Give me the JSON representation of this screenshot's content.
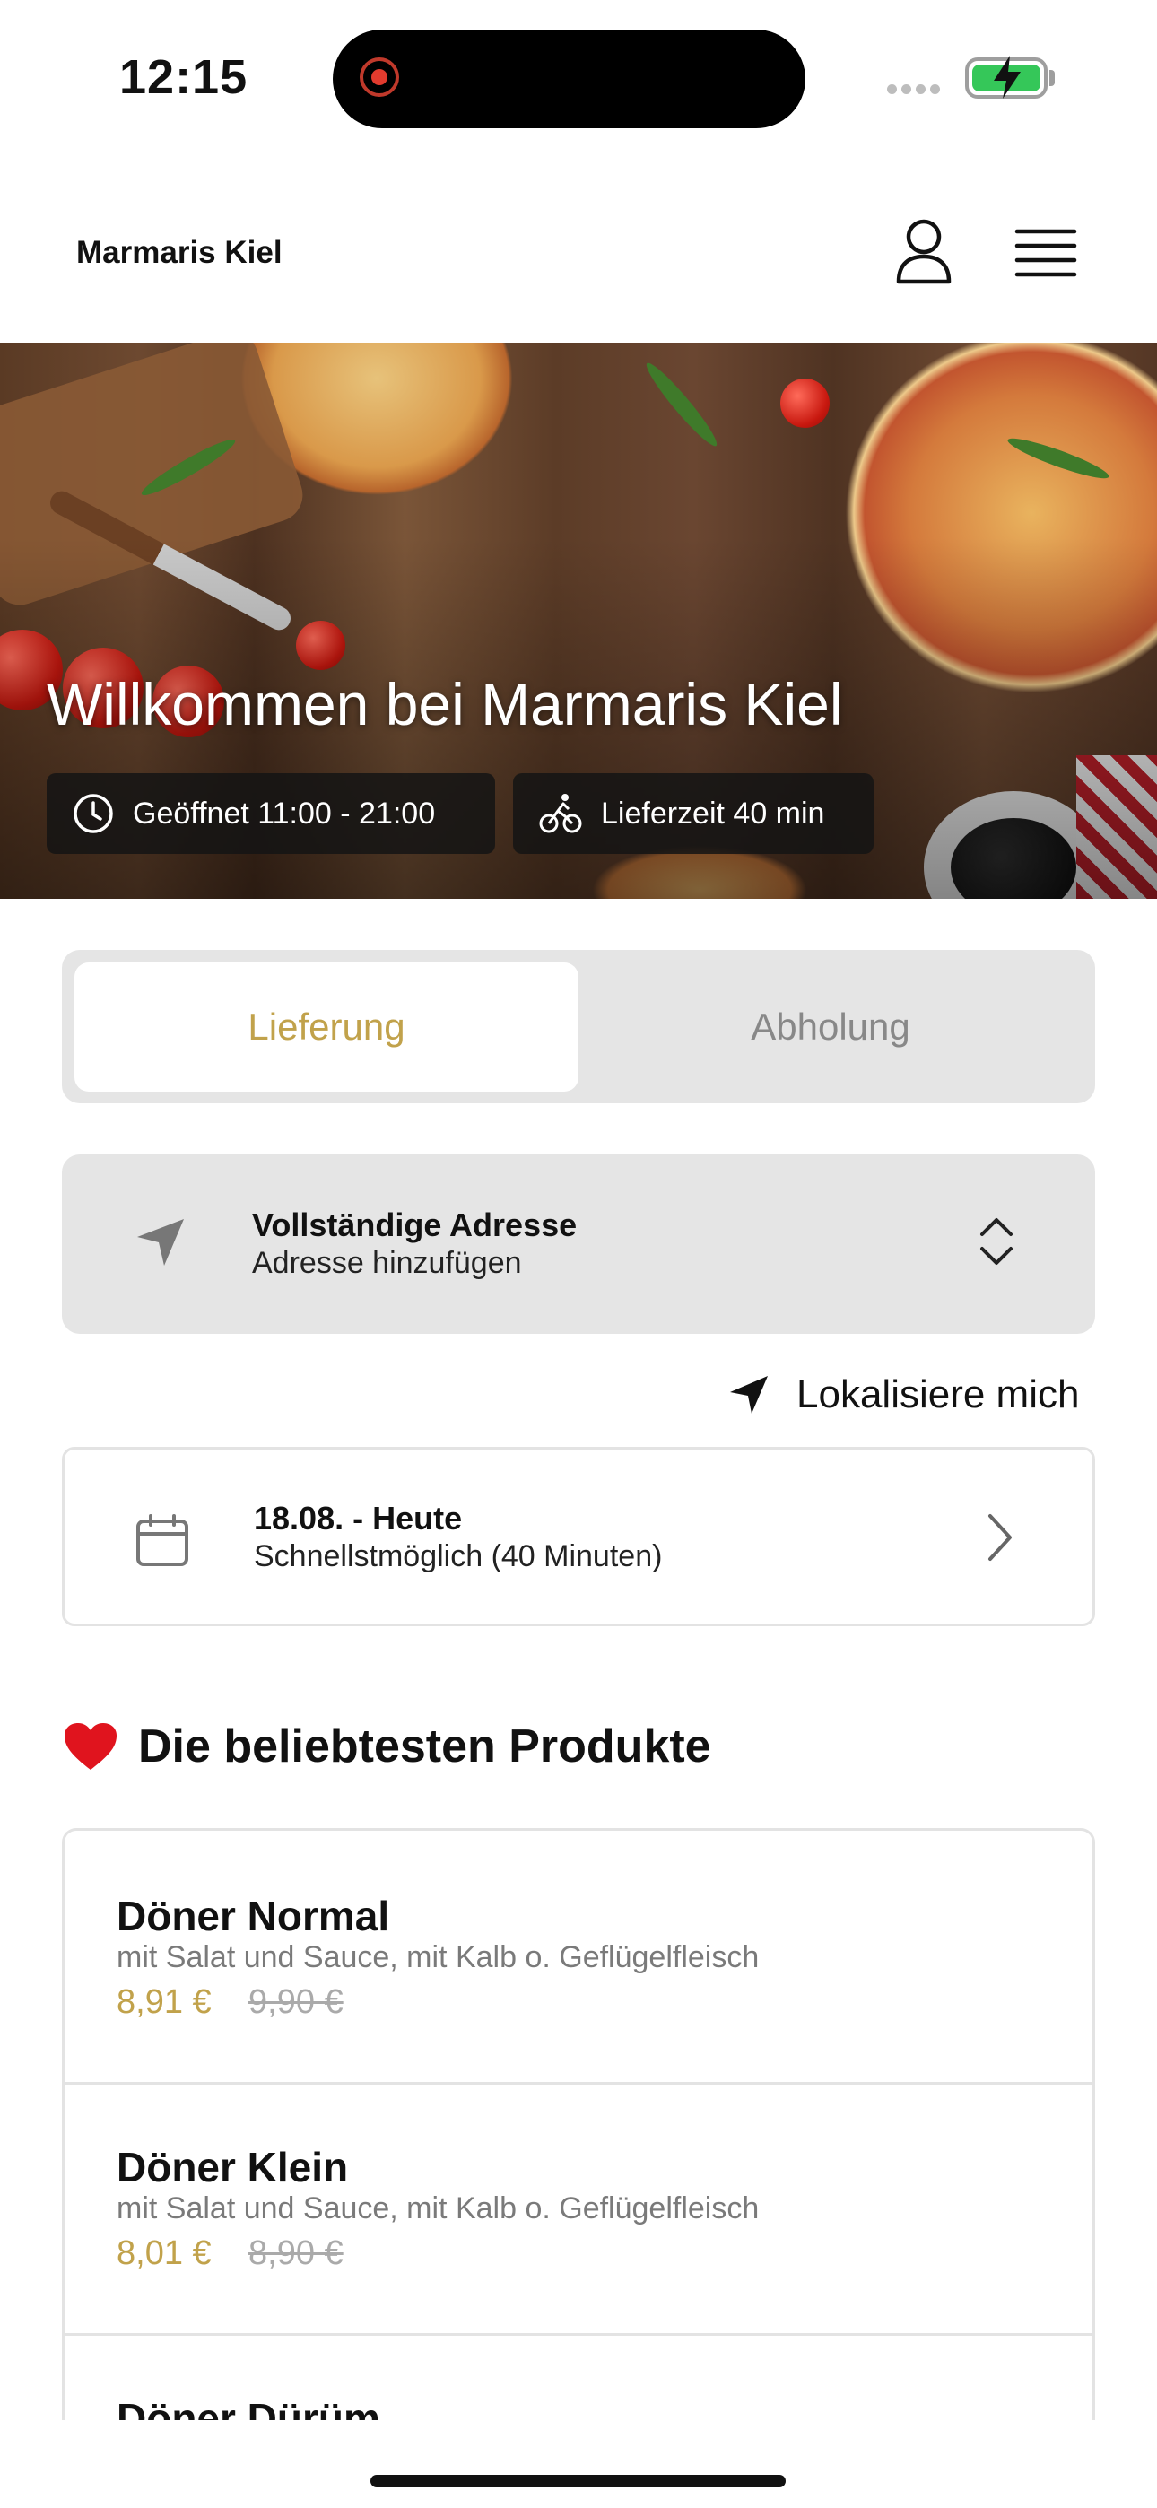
{
  "status_bar": {
    "time": "12:15"
  },
  "header": {
    "brand": "Marmaris Kiel"
  },
  "hero": {
    "title": "Willkommen bei Marmaris Kiel",
    "opening_hours": "Geöffnet 11:00 - 21:00",
    "delivery_time": "Lieferzeit 40 min"
  },
  "order_mode": {
    "options": [
      "Lieferung",
      "Abholung"
    ],
    "selected": "Lieferung"
  },
  "address": {
    "title": "Vollständige Adresse",
    "subtitle": "Adresse hinzufügen"
  },
  "locate_me": "Lokalisiere mich",
  "delivery_date": {
    "title": "18.08. - Heute",
    "subtitle": "Schnellstmöglich (40 Minuten)"
  },
  "popular": {
    "title": "Die beliebtesten Produkte",
    "products": [
      {
        "name": "Döner Normal",
        "description": "mit Salat und Sauce, mit Kalb o. Geflügelfleisch",
        "price": "8,91 €",
        "old_price": "9,90 €"
      },
      {
        "name": "Döner Klein",
        "description": "mit Salat und Sauce, mit Kalb o. Geflügelfleisch",
        "price": "8,01 €",
        "old_price": "8,90 €"
      },
      {
        "name": "Döner Dürüm"
      }
    ]
  },
  "colors": {
    "accent": "#c1a24b",
    "muted_bg": "#e5e5e5"
  }
}
